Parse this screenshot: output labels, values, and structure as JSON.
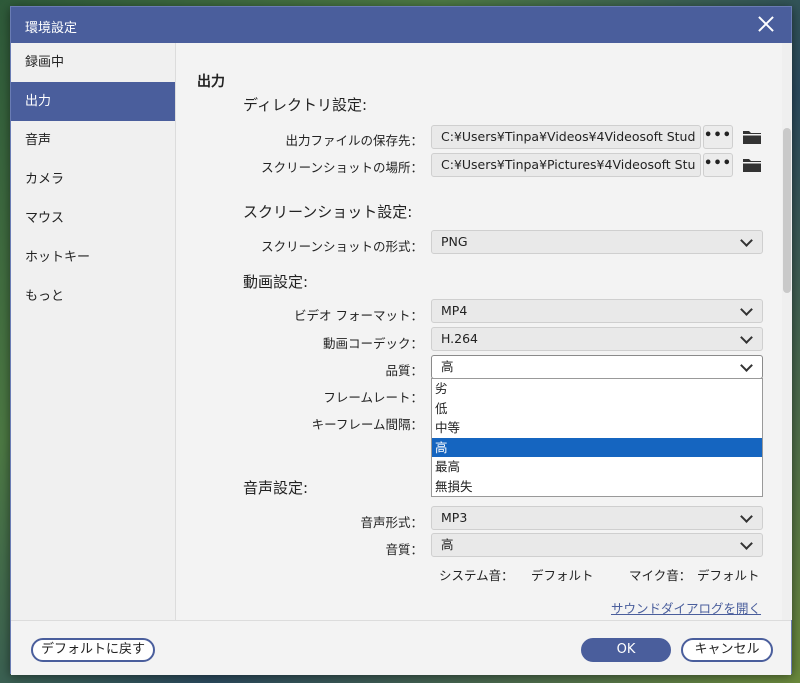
{
  "window": {
    "title": "環境設定"
  },
  "sidebar": {
    "items": [
      {
        "label": "録画中"
      },
      {
        "label": "出力"
      },
      {
        "label": "音声"
      },
      {
        "label": "カメラ"
      },
      {
        "label": "マウス"
      },
      {
        "label": "ホットキー"
      },
      {
        "label": "もっと"
      }
    ],
    "active_index": 1
  },
  "main": {
    "section_title": "出力",
    "directory": {
      "title": "ディレクトリ設定:",
      "output_label": "出力ファイルの保存先：",
      "output_path": "C:¥Users¥Tinpa¥Videos¥4Videosoft Stud",
      "screenshot_label": "スクリーンショットの場所：",
      "screenshot_path": "C:¥Users¥Tinpa¥Pictures¥4Videosoft Stu",
      "browse_label": "•••"
    },
    "screenshot": {
      "title": "スクリーンショット設定:",
      "format_label": "スクリーンショットの形式：",
      "format_value": "PNG"
    },
    "video": {
      "title": "動画設定:",
      "format_label": "ビデオ フォーマット：",
      "format_value": "MP4",
      "codec_label": "動画コーデック：",
      "codec_value": "H.264",
      "quality_label": "品質：",
      "quality_value": "高",
      "framerate_label": "フレームレート：",
      "keyframe_label": "キーフレーム間隔：",
      "quality_options": [
        "劣",
        "低",
        "中等",
        "高",
        "最高",
        "無損失"
      ],
      "quality_selected_index": 3
    },
    "audio": {
      "title": "音声設定:",
      "format_label": "音声形式：",
      "format_value": "MP3",
      "quality_label": "音質：",
      "quality_value": "高",
      "system_sound_label": "システム音：",
      "system_sound_value": "デフォルト",
      "mic_label": "マイク音：",
      "mic_value": "デフォルト",
      "sound_dialog_link": "サウンドダイアログを開く"
    }
  },
  "footer": {
    "reset_label": "デフォルトに戻す",
    "ok_label": "OK",
    "cancel_label": "キャンセル"
  },
  "colors": {
    "accent": "#4a5e9c",
    "selection": "#1565c0"
  }
}
